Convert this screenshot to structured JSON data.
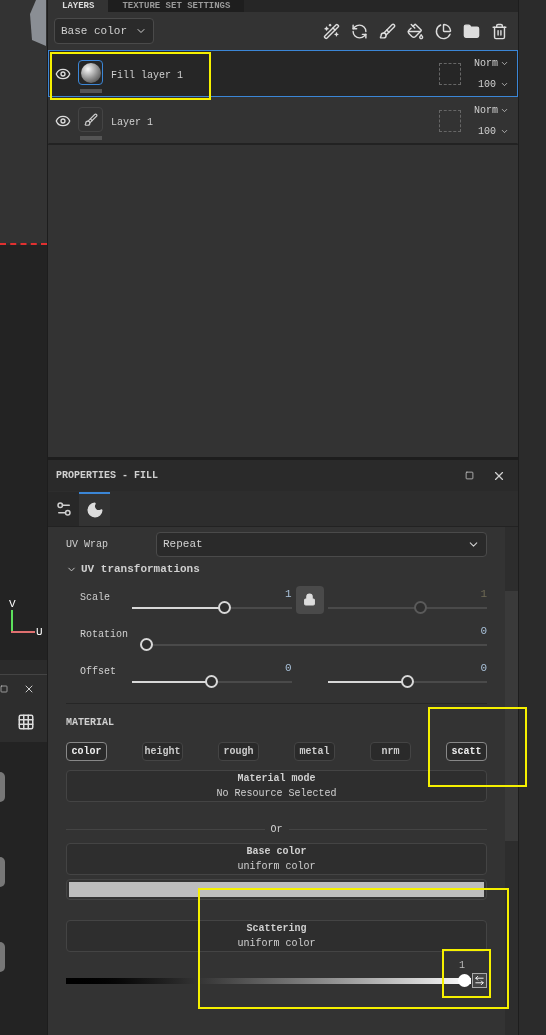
{
  "viewport": {
    "axis_labels": [
      "V",
      "U"
    ]
  },
  "layers_panel": {
    "tabs": [
      {
        "label": "LAYERS",
        "selected": true
      },
      {
        "label": "TEXTURE SET SETTINGS",
        "selected": false
      }
    ],
    "channel_dropdown": "Base color",
    "layers": [
      {
        "name": "Fill layer 1",
        "kind": "fill",
        "selected": true,
        "blend": "Norm",
        "opacity": "100"
      },
      {
        "name": "Layer 1",
        "kind": "paint",
        "selected": false,
        "blend": "Norm",
        "opacity": "100"
      }
    ]
  },
  "properties": {
    "title": "PROPERTIES - FILL",
    "tabs": [
      {
        "kind": "settings",
        "selected": false
      },
      {
        "kind": "material",
        "selected": true
      }
    ],
    "uv_wrap": {
      "label": "UV Wrap",
      "value": "Repeat"
    },
    "uv_transformations": {
      "title": "UV transformations",
      "expanded": true,
      "rows": [
        {
          "label": "Scale",
          "kind": "pair",
          "sliders": [
            {
              "reading": "1",
              "level": 0.59,
              "disabled": false
            },
            {
              "reading": "1",
              "level": 0.59,
              "disabled": true
            }
          ]
        },
        {
          "label": "Rotation",
          "kind": "single",
          "sliders": [
            {
              "reading": "0",
              "level": 0,
              "disabled": false
            }
          ]
        },
        {
          "label": "Offset",
          "kind": "pair",
          "sliders": [
            {
              "reading": "0",
              "level": 0.5,
              "disabled": false
            },
            {
              "reading": "0",
              "level": 0.5,
              "disabled": false
            }
          ]
        }
      ]
    },
    "material": {
      "title": "MATERIAL",
      "channels": [
        {
          "label": "color",
          "on": true
        },
        {
          "label": "height",
          "on": false
        },
        {
          "label": "rough",
          "on": false
        },
        {
          "label": "metal",
          "on": false
        },
        {
          "label": "nrm",
          "on": false
        },
        {
          "label": "scatt",
          "on": true
        }
      ],
      "material_mode": {
        "title": "Material mode",
        "value": "No Resource Selected"
      },
      "separator": "Or",
      "base_color": {
        "title": "Base color",
        "mode": "uniform color"
      },
      "scattering": {
        "title": "Scattering",
        "mode": "uniform color",
        "reading": "1",
        "level": 1
      }
    }
  }
}
